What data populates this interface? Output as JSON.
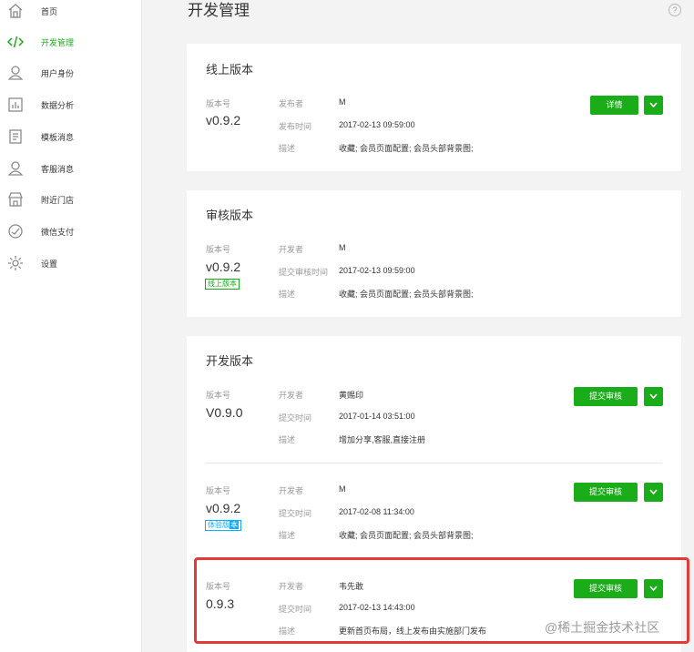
{
  "sidebar": {
    "items": [
      {
        "label": "首页",
        "icon": "home-icon"
      },
      {
        "label": "开发管理",
        "icon": "code-icon",
        "active": true
      },
      {
        "label": "用户身份",
        "icon": "user-icon"
      },
      {
        "label": "数据分析",
        "icon": "chart-icon"
      },
      {
        "label": "模板消息",
        "icon": "document-icon"
      },
      {
        "label": "客服消息",
        "icon": "support-user-icon"
      },
      {
        "label": "附近门店",
        "icon": "store-icon"
      },
      {
        "label": "微信支付",
        "icon": "payment-icon"
      },
      {
        "label": "设置",
        "icon": "gear-icon"
      }
    ]
  },
  "header": {
    "title": "开发管理",
    "help": "?"
  },
  "online": {
    "title": "线上版本",
    "version_label": "版本号",
    "version": "v0.9.2",
    "publisher_key": "发布者",
    "publisher": "M",
    "time_key": "发布时间",
    "time": "2017-02-13 09:59:00",
    "desc_key": "描述",
    "desc": "收藏; 会员页面配置; 会员头部背景图;",
    "detail_button": "详情"
  },
  "review": {
    "title": "审核版本",
    "version_label": "版本号",
    "version": "v0.9.2",
    "tag": "线上版本",
    "developer_key": "开发者",
    "developer": "M",
    "time_key": "提交审核时间",
    "time": "2017-02-13 09:59:00",
    "desc_key": "描述",
    "desc": "收藏; 会员页面配置; 会员头部背景图;"
  },
  "dev": {
    "title": "开发版本",
    "submit_button": "提交审核",
    "entries": [
      {
        "version_label": "版本号",
        "version": "V0.9.0",
        "developer_key": "开发者",
        "developer": "黄赐印",
        "time_key": "提交时间",
        "time": "2017-01-14 03:51:00",
        "desc_key": "描述",
        "desc": "增加分享,客服,直接注册"
      },
      {
        "version_label": "版本号",
        "version": "v0.9.2",
        "tag": "体验版",
        "tag_extra": "本",
        "developer_key": "开发者",
        "developer": "M",
        "time_key": "提交时间",
        "time": "2017-02-08 11:34:00",
        "desc_key": "描述",
        "desc": "收藏; 会员页面配置; 会员头部背景图;"
      },
      {
        "version_label": "版本号",
        "version": "0.9.3",
        "developer_key": "开发者",
        "developer": "韦先敢",
        "time_key": "提交时间",
        "time": "2017-02-13 14:43:00",
        "desc_key": "描述",
        "desc": "更新首页布局，线上发布由实施部门发布"
      }
    ]
  },
  "watermark": "@稀土掘金技术社区",
  "colors": {
    "accent": "#1aad19",
    "highlight": "#e53935",
    "tag_blue": "#10aeff"
  }
}
